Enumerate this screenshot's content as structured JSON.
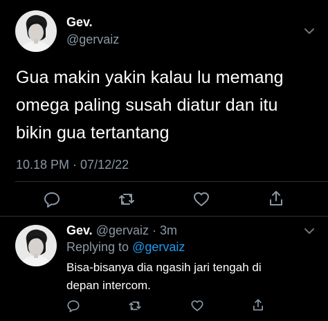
{
  "main_tweet": {
    "display_name": "Gev.",
    "handle": "@gervaiz",
    "text_lines": [
      "Gua makin yakin kalau lu memang",
      "omega paling susah diatur dan itu",
      "bikin gua tertantang"
    ],
    "timestamp": "10.18 PM · 07/12/22",
    "actions": [
      "reply-icon",
      "retweet-icon",
      "like-icon",
      "share-icon"
    ]
  },
  "reply_tweet": {
    "display_name": "Gev.",
    "meta": "@gervaiz · 3m",
    "replying_label": "Replying to",
    "replying_to": "@gervaiz",
    "text_lines": [
      "Bisa-bisanya dia ngasih jari tengah di",
      "depan intercom."
    ],
    "actions": [
      "reply-icon",
      "retweet-icon",
      "like-icon",
      "share-icon"
    ]
  },
  "colors": {
    "background": "#000000",
    "primary_text": "#ffffff",
    "secondary_text": "#8b98a5",
    "link": "#1d9bf0",
    "divider": "#2f3336"
  }
}
